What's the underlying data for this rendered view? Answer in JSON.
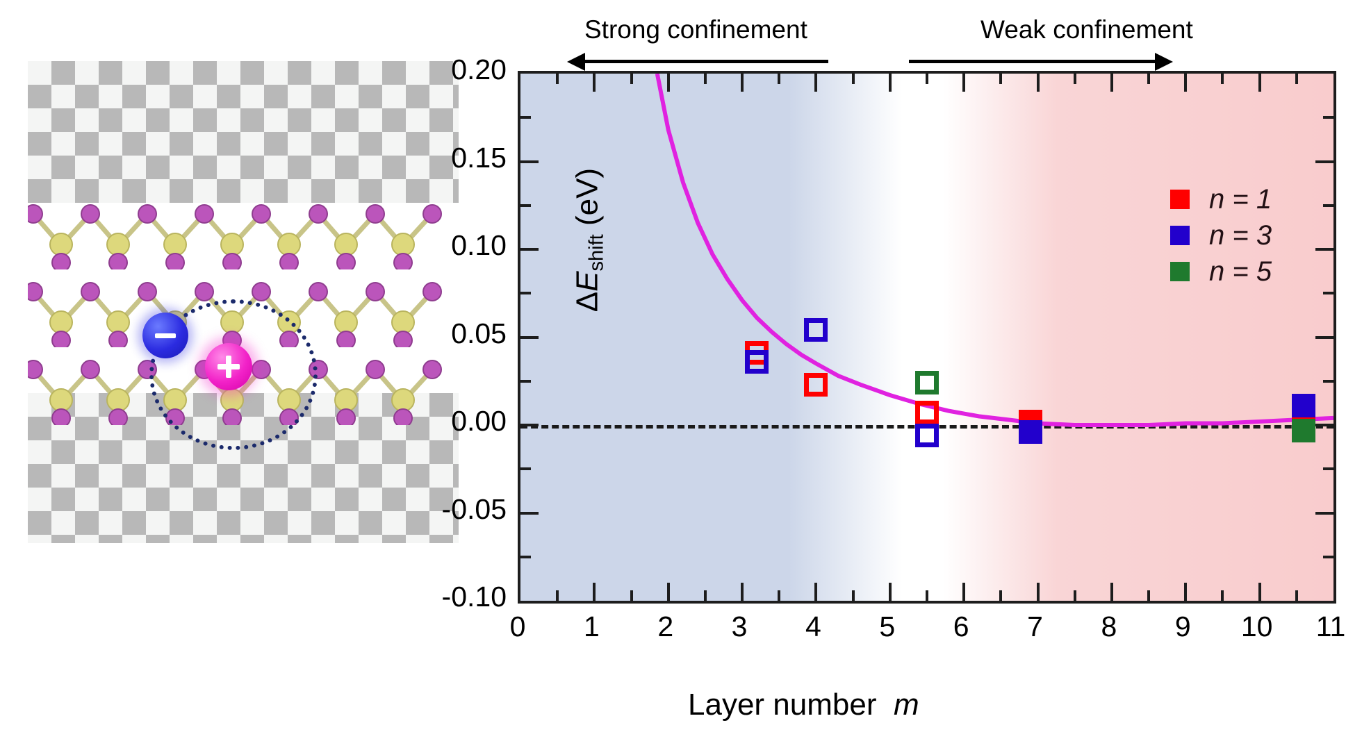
{
  "figure": {
    "left_panel": {
      "name": "exciton-in-layered-crystal-schematic",
      "electron_symbol": "−",
      "hole_symbol": "+",
      "electron_color": "#2b2be0",
      "hole_color": "#f222c8",
      "exciton_orbit_color": "#1b2a6b",
      "chalcogen_color": "#bb55bb",
      "metal_color": "#dcd87a",
      "layer_count": 3
    },
    "regions": {
      "strong_label": "Strong confinement",
      "weak_label": "Weak confinement",
      "strong_arrow": "left-arrow",
      "weak_arrow": "right-arrow"
    },
    "legend": {
      "items": [
        {
          "label": "n = 1",
          "n": 1,
          "color": "#ff0000"
        },
        {
          "label": "n = 3",
          "n": 3,
          "color": "#2200cc"
        },
        {
          "label": "n = 5",
          "n": 5,
          "color": "#1f7a2e"
        }
      ]
    }
  },
  "chart_data": {
    "type": "scatter",
    "title": "",
    "xlabel": "Layer number  m",
    "ylabel": "ΔE_shift (eV)",
    "xlim": [
      0,
      11
    ],
    "ylim": [
      -0.1,
      0.2
    ],
    "xticks": [
      "0",
      "1",
      "2",
      "3",
      "4",
      "5",
      "6",
      "7",
      "8",
      "9",
      "10",
      "11"
    ],
    "xtick_values": [
      0,
      1,
      2,
      3,
      4,
      5,
      6,
      7,
      8,
      9,
      10,
      11
    ],
    "yticks": [
      "0.20",
      "0.15",
      "0.10",
      "0.05",
      "0.00",
      "-0.05",
      "-0.10"
    ],
    "ytick_values": [
      0.2,
      0.15,
      0.1,
      0.05,
      0.0,
      -0.05,
      -0.1
    ],
    "minor_ticks": true,
    "grid": false,
    "zero_reference_line": {
      "y": 0.0,
      "style": "dashed",
      "color": "#1a1a1a"
    },
    "background_bands": [
      {
        "label": "Strong confinement",
        "x_range": [
          0,
          5
        ],
        "color": "#ccd6e9"
      },
      {
        "label": "Weak confinement",
        "x_range": [
          6,
          11
        ],
        "color": "#f9cccd"
      }
    ],
    "series": [
      {
        "name": "n = 1",
        "color": "#ff0000",
        "points": [
          {
            "x": 3.2,
            "y": 0.041,
            "filled": false
          },
          {
            "x": 4.0,
            "y": 0.023,
            "filled": false
          },
          {
            "x": 5.5,
            "y": 0.007,
            "filled": false
          },
          {
            "x": 6.9,
            "y": 0.002,
            "filled": true
          },
          {
            "x": 10.6,
            "y": 0.004,
            "filled": true
          }
        ]
      },
      {
        "name": "n = 3",
        "color": "#2200cc",
        "points": [
          {
            "x": 3.2,
            "y": 0.036,
            "filled": false
          },
          {
            "x": 4.0,
            "y": 0.054,
            "filled": false
          },
          {
            "x": 5.5,
            "y": -0.006,
            "filled": false
          },
          {
            "x": 6.9,
            "y": -0.004,
            "filled": true
          },
          {
            "x": 10.6,
            "y": 0.011,
            "filled": true
          }
        ]
      },
      {
        "name": "n = 5",
        "color": "#1f7a2e",
        "points": [
          {
            "x": 5.5,
            "y": 0.024,
            "filled": false
          },
          {
            "x": 10.6,
            "y": -0.003,
            "filled": true
          }
        ]
      }
    ],
    "fit_curve": {
      "name": "confinement-fit",
      "color": "#e022e0",
      "x": [
        1.85,
        2.0,
        2.2,
        2.4,
        2.6,
        2.8,
        3.0,
        3.2,
        3.4,
        3.6,
        3.8,
        4.0,
        4.3,
        4.6,
        5.0,
        5.4,
        5.8,
        6.2,
        6.6,
        7.0,
        7.5,
        8.0,
        8.5,
        9.0,
        9.5,
        10.0,
        10.5,
        11.0
      ],
      "y": [
        0.2,
        0.168,
        0.138,
        0.115,
        0.097,
        0.083,
        0.071,
        0.061,
        0.053,
        0.046,
        0.04,
        0.035,
        0.028,
        0.023,
        0.017,
        0.012,
        0.008,
        0.005,
        0.003,
        0.001,
        0.0,
        0.0,
        0.0,
        0.001,
        0.001,
        0.002,
        0.003,
        0.004
      ]
    }
  }
}
